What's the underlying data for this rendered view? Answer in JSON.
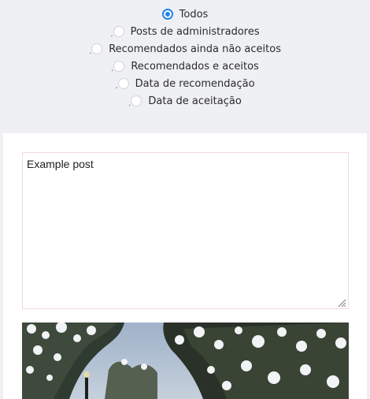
{
  "filter_options": [
    {
      "label": "Todos",
      "checked": true
    },
    {
      "label": "Posts de administradores",
      "checked": false
    },
    {
      "label": "Recomendados ainda não aceitos",
      "checked": false
    },
    {
      "label": "Recomendados e aceitos",
      "checked": false
    },
    {
      "label": "Data de recomendação",
      "checked": false
    },
    {
      "label": "Data de aceitação",
      "checked": false
    }
  ],
  "post_editor": {
    "value": "Example post"
  },
  "colors": {
    "radio_accent": "#2383e8",
    "page_background": "#eff0f4",
    "textarea_border": "#f1d8dc"
  },
  "icons": {
    "textarea_resize": "resize-grip-icon"
  }
}
